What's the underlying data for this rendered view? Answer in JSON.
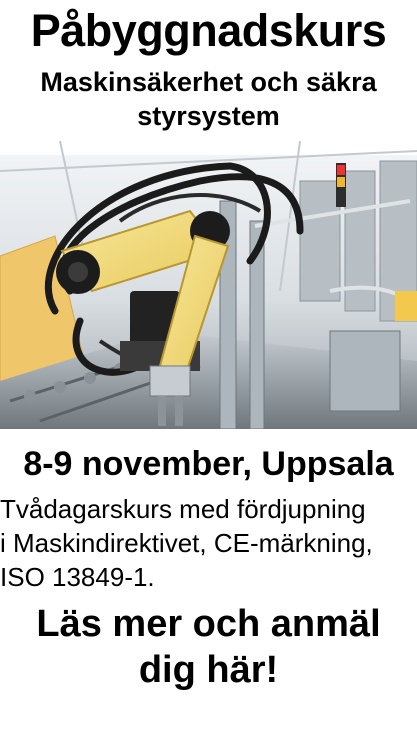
{
  "ad": {
    "title": "Påbyggnadskurs",
    "subtitle_line1": "Maskinsäkerhet och säkra",
    "subtitle_line2": "styrsystem",
    "date_location": "8-9 november, Uppsala",
    "description_lines": [
      "Tvådagarskurs med fördjupning",
      "i Maskindirektivet, CE-märkning,",
      "ISO 13849-1."
    ],
    "cta_line1": "Läs mer och anmäl",
    "cta_line2": "dig här!"
  }
}
